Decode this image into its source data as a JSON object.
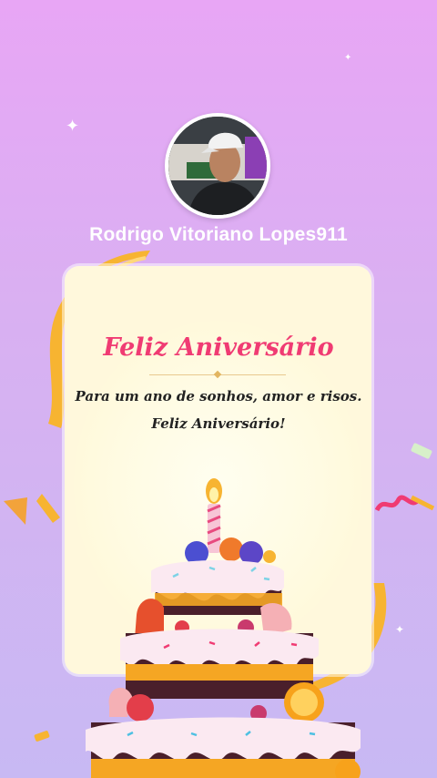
{
  "profile": {
    "username": "Rodrigo Vitoriano Lopes911"
  },
  "card": {
    "title": "Feliz Aniversário",
    "message_line1": "Para um ano de sonhos, amor e risos.",
    "message_line2": "Feliz Aniversário!"
  },
  "colors": {
    "background_top": "#e8a6f5",
    "background_bottom": "#c8b9f3",
    "card_background": "#fff8dc",
    "title_color": "#f03b73",
    "ribbon_color": "#f7b431"
  },
  "icons": {
    "sparkle": "sparkle-icon",
    "cake": "birthday-cake-icon"
  }
}
